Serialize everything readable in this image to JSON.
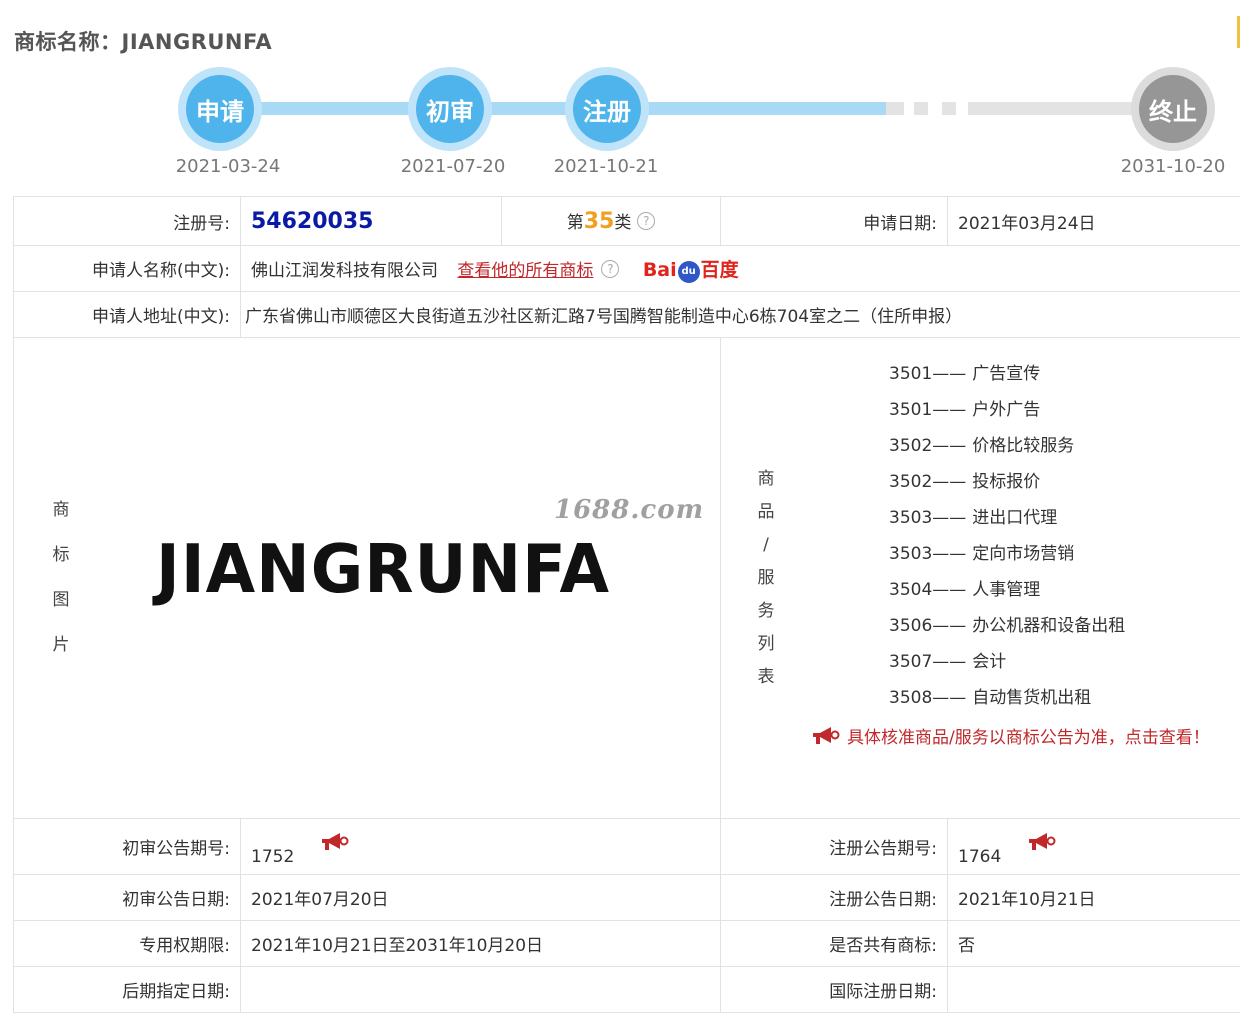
{
  "header": {
    "title": "商标名称：JIANGRUNFA"
  },
  "timeline": {
    "steps": [
      {
        "label": "申请",
        "date": "2021-03-24"
      },
      {
        "label": "初审",
        "date": "2021-07-20"
      },
      {
        "label": "注册",
        "date": "2021-10-21"
      },
      {
        "label": "终止",
        "date": "2031-10-20"
      }
    ]
  },
  "info": {
    "reg_no_label": "注册号:",
    "reg_no": "54620035",
    "class_prefix": "第",
    "class_num": "35",
    "class_suffix": "类",
    "help_icon": "?",
    "apply_date_label": "申请日期:",
    "apply_date": "2021年03月24日",
    "applicant_label": "申请人名称(中文):",
    "applicant": "佛山江润发科技有限公司",
    "view_all_link": "查看他的所有商标",
    "baidu_left": "Bai",
    "baidu_paw": "du",
    "baidu_right": "百度",
    "address_label": "申请人地址(中文):",
    "address": "广东省佛山市顺德区大良街道五沙社区新汇路7号国腾智能制造中心6栋704室之二（住所申报）"
  },
  "trademark": {
    "image_label": [
      "商",
      "标",
      "图",
      "片"
    ],
    "logo_text": "JIANGRUNFA",
    "watermark": "1688.com"
  },
  "services": {
    "label": [
      "商",
      "品",
      "/",
      "服",
      "务",
      "列",
      "表"
    ],
    "dash": "——",
    "items": [
      {
        "code": "3501",
        "name": "广告宣传"
      },
      {
        "code": "3501",
        "name": "户外广告"
      },
      {
        "code": "3502",
        "name": "价格比较服务"
      },
      {
        "code": "3502",
        "name": "投标报价"
      },
      {
        "code": "3503",
        "name": "进出口代理"
      },
      {
        "code": "3503",
        "name": "定向市场营销"
      },
      {
        "code": "3504",
        "name": "人事管理"
      },
      {
        "code": "3506",
        "name": "办公机器和设备出租"
      },
      {
        "code": "3507",
        "name": "会计"
      },
      {
        "code": "3508",
        "name": "自动售货机出租"
      }
    ],
    "notice": "具体核准商品/服务以商标公告为准，点击查看！"
  },
  "publication": {
    "prelim_no_label": "初审公告期号:",
    "prelim_no": "1752",
    "reg_pub_no_label": "注册公告期号:",
    "reg_pub_no": "1764",
    "prelim_date_label": "初审公告日期:",
    "prelim_date": "2021年07月20日",
    "reg_pub_date_label": "注册公告日期:",
    "reg_pub_date": "2021年10月21日",
    "exclusive_label": "专用权期限:",
    "exclusive": "2021年10月21日至2031年10月20日",
    "shared_label": "是否共有商标:",
    "shared": "否",
    "later_date_label": "后期指定日期:",
    "later_date": "",
    "intl_date_label": "国际注册日期:",
    "intl_date": ""
  },
  "colors": {
    "step_active": "#4fb4ec",
    "step_inactive": "#969696",
    "link_red": "#c0282c",
    "reg_no_blue": "#0a1aa6",
    "class_orange": "#f0a020"
  }
}
